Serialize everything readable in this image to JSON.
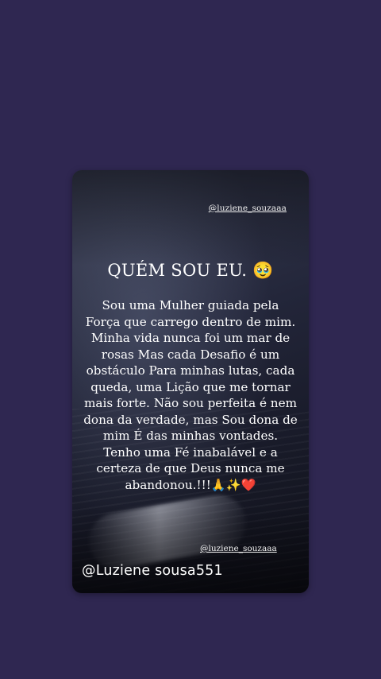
{
  "story": {
    "handle_top": "@luziene_souzaaa",
    "title": "QUÉM SOU EU. 🥹",
    "body": "Sou uma Mulher guiada pela Força que carrego dentro de mim. Minha vida nunca foi um mar de rosas Mas cada Desafio é um obstáculo Para minhas lutas, cada queda, uma Lição que me tornar mais forte. Não sou perfeita é nem dona da verdade, mas Sou dona de mim É das minhas vontades. Tenho uma Fé inabalável e a certeza de que Deus nunca me abandonou.!!!🙏✨❤️",
    "handle_bottom": "@luziene_souzaaa",
    "watermark": "@Luziene sousa551"
  },
  "colors": {
    "background": "#2f2751",
    "text": "#ffffff"
  }
}
